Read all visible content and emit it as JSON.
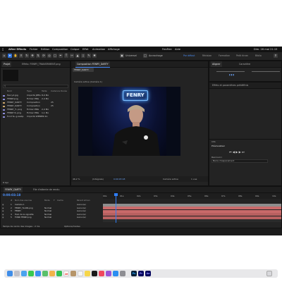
{
  "menubar": {
    "app_name": "After Effects",
    "items": [
      "Fichier",
      "Edition",
      "Composition",
      "Calque",
      "Effet",
      "Animation",
      "Affichage",
      "Fenêtre",
      "Aide"
    ],
    "clock": "Dim. 26 mai 21:15"
  },
  "toolbar": {
    "universal_label": "Universel",
    "snap_label": "Accrochage",
    "workspaces": [
      "Par défaut",
      "Révision",
      "Formation",
      "Petit écran",
      "Biblio"
    ]
  },
  "project_panel": {
    "tab_label": "Projet",
    "file_tab": "Effets: FENRY_TRANSPARENT.png",
    "search_placeholder": "",
    "columns": [
      "Nom",
      "Type",
      "Taille",
      "Cadence",
      "Durée"
    ],
    "items": [
      {
        "name": "Fenry2.jpg",
        "type": "Importé JPEG",
        "size": "8,0 Mo",
        "fps": "",
        "dur": ""
      },
      {
        "name": "FENRY.png",
        "type": "Fichier PNG",
        "size": "2,4 Mo",
        "fps": "",
        "dur": ""
      },
      {
        "name": "FENRY_DARTY",
        "type": "Composition",
        "size": "",
        "fps": "25",
        "dur": "0:00:10:00"
      },
      {
        "name": "FENRY_DARTY",
        "type": "Composition",
        "size": "",
        "fps": "25",
        "dur": "0:00:10:00"
      },
      {
        "name": "FENRY_T...png",
        "type": "Fichier PNG",
        "size": "2,4 Mo",
        "fps": "",
        "dur": ""
      },
      {
        "name": "FENRY R..png",
        "type": "Fichier PNG",
        "size": "1,1 Mo",
        "fps": "",
        "dur": ""
      },
      {
        "name": "fond fe..g.webp",
        "type": "Importé WEBP",
        "size": "39 Ko",
        "fps": "",
        "dur": ""
      }
    ],
    "bpc_label": "8 bpc"
  },
  "composition_panel": {
    "tab_label": "Composition FENRY_DARTY",
    "comp_tab": "FENRY_DARTY",
    "camera_label": "Caméra active (Caméra 1)",
    "neon_text": "FENRY",
    "zoom": "46,2 %",
    "resolution": "(Intégrale)",
    "timecode": "0:00:03:18",
    "camera_dropdown": "Caméra active",
    "views": "1 vue"
  },
  "right_panels": {
    "tab1": "Info",
    "tab2": "Audio",
    "tab3": "Aperçu",
    "tab4": "Bibliothèques",
    "effects_tab": "Effets et paramètres prédéfinis",
    "align_tab": "Aligner",
    "character_tab": "Caractère",
    "paragraph_tab": "Paragraphe",
    "tracker_tab": "Suivi",
    "preview_label": "Prévisualiser",
    "shortcut_label": "Raccourci",
    "shortcut_value": "Barre d'espacement",
    "audio_label": "Lire l'audio",
    "ram_label": "Lire depuis"
  },
  "timeline": {
    "tab_label": "FENRY_DARTY",
    "queue_tab": "File d'attente de rendu",
    "timecode": "0:00:03:18",
    "columns": [
      "#",
      "Nom des sources",
      "Mode",
      "T",
      "Cache",
      "Parent et lien"
    ],
    "layers": [
      {
        "num": "1",
        "name": "Caméra 1",
        "mode": "",
        "parent": "Aucun(e)",
        "color": "#b0b0b0"
      },
      {
        "num": "2",
        "name": "FENRY_TLANS.png",
        "mode": "Normal",
        "parent": "Aucun(e)",
        "color": "#d67c7c"
      },
      {
        "num": "3",
        "name": "FENRY",
        "mode": "Normal",
        "parent": "Aucun(e)",
        "color": "#d67c7c"
      },
      {
        "num": "4",
        "name": "Halo de la vignette",
        "mode": "Normal",
        "parent": "Aucun(e)",
        "color": "#d67c7c"
      },
      {
        "num": "5",
        "name": "FOND FENRY.png",
        "mode": "Normal",
        "parent": "Aucun(e)",
        "color": "#d67c7c"
      }
    ],
    "ruler": [
      "00s",
      "01s",
      "02s",
      "03s",
      "04s",
      "05s",
      "06s",
      "07s",
      "08s",
      "09s",
      "10s"
    ],
    "render_label": "Temps de rendu des images : 2 ms",
    "toggle_label": "Options/modes"
  },
  "dock": {
    "apps": [
      "Finder",
      "Launchpad",
      "Safari",
      "Messages",
      "Mail",
      "Cartes",
      "Photos",
      "FaceTime",
      "Calendrier",
      "Contacts",
      "Rappels",
      "Notes",
      "TV",
      "Musique",
      "Podcasts",
      "App Store",
      "Réglages",
      "Ps",
      "Pr",
      "Ae",
      "Corbeille"
    ]
  },
  "colors": {
    "accent_blue": "#2d6fd6",
    "neon": "#5fa9ff",
    "track_red": "#c96a6a",
    "playhead": "#2f7df5"
  }
}
